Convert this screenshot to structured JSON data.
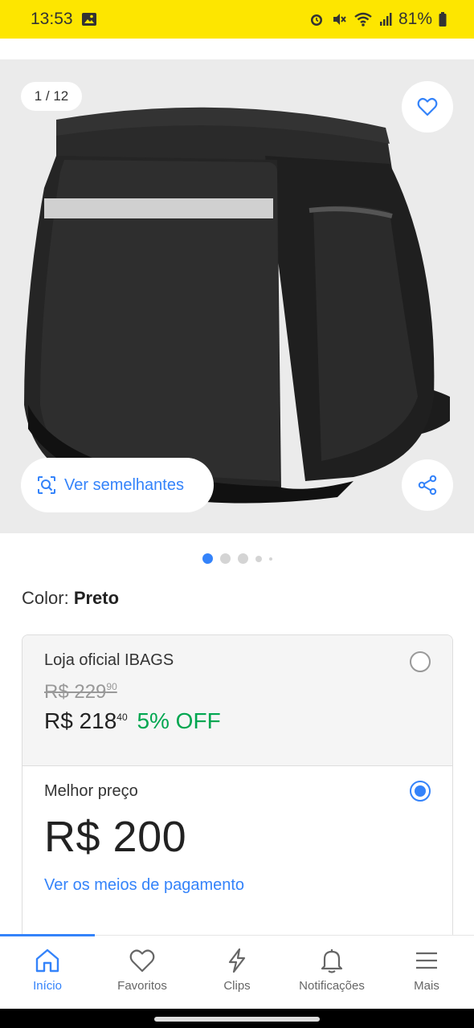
{
  "status": {
    "time": "13:53",
    "battery": "81%"
  },
  "gallery": {
    "counter": "1 / 12",
    "similar_label": "Ver semelhantes",
    "dot_count": 5,
    "active_dot": 0
  },
  "product": {
    "color_label": "Color:",
    "color_value": "Preto"
  },
  "offers": {
    "official": {
      "seller": "Loja oficial IBAGS",
      "old_price": "R$ 229",
      "old_cents": "90",
      "price": "R$ 218",
      "price_cents": "40",
      "discount": "5% OFF",
      "selected": false
    },
    "best": {
      "label": "Melhor preço",
      "price": "R$ 200",
      "payment_link": "Ver os meios de pagamento",
      "selected": true
    }
  },
  "nav": {
    "items": [
      {
        "label": "Início",
        "icon": "home-icon",
        "active": true
      },
      {
        "label": "Favoritos",
        "icon": "heart-icon",
        "active": false
      },
      {
        "label": "Clips",
        "icon": "lightning-icon",
        "active": false
      },
      {
        "label": "Notificações",
        "icon": "bell-icon",
        "active": false
      },
      {
        "label": "Mais",
        "icon": "menu-icon",
        "active": false
      }
    ]
  },
  "colors": {
    "brand_yellow": "#fde600",
    "accent_blue": "#3483fa",
    "discount_green": "#00a650"
  }
}
